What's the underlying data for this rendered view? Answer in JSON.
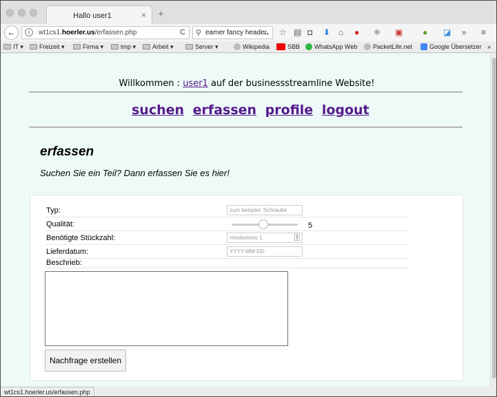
{
  "tab": {
    "title": "Hallo user1",
    "close": "×",
    "new": "+"
  },
  "nav": {
    "back": "←",
    "url_plain": "wt1cs1.",
    "url_domain": "hoerler.us",
    "url_path": "/erfassen.php",
    "reload": "C",
    "search_value": "eamer fancy header",
    "search_go": "→"
  },
  "bookmarks": [
    {
      "label": "IT",
      "type": "folder",
      "has_menu": true
    },
    {
      "label": "Freizeit",
      "type": "folder",
      "has_menu": true
    },
    {
      "label": "Firma",
      "type": "folder",
      "has_menu": true
    },
    {
      "label": "tmp",
      "type": "folder",
      "has_menu": true
    },
    {
      "label": "Arbeit",
      "type": "folder",
      "has_menu": true
    },
    {
      "label": "Server",
      "type": "folder",
      "has_menu": true
    },
    {
      "label": "Wikipedia",
      "type": "link"
    },
    {
      "label": "SBB",
      "type": "link"
    },
    {
      "label": "WhatsApp Web",
      "type": "link"
    },
    {
      "label": "PacketLife.net",
      "type": "link"
    },
    {
      "label": "Google Übersetzer",
      "type": "link"
    },
    {
      "label": "»",
      "type": "more"
    }
  ],
  "welcome": {
    "prefix": "Willkommen : ",
    "user": "user1",
    "suffix": " auf der businessstreamline Website!"
  },
  "menu": [
    "suchen",
    "erfassen",
    "profile",
    "logout"
  ],
  "page": {
    "title": "erfassen",
    "subtitle": "Suchen Sie ein Teil? Dann erfassen Sie es hier!"
  },
  "form": {
    "typ_label": "Typ:",
    "typ_placeholder": "zum beispiel: Schraube",
    "quality_label": "Qualität:",
    "quality_value": "5",
    "quantity_label": "Benötigte Stückzahl:",
    "quantity_placeholder": "mindestens 1",
    "date_label": "Lieferdatum:",
    "date_placeholder": "YYYY-MM-DD",
    "desc_label": "Beschrieb:",
    "submit": "Nachfrage erstellen"
  },
  "status_url": "wt1cs1.hoerler.us/erfassen.php"
}
